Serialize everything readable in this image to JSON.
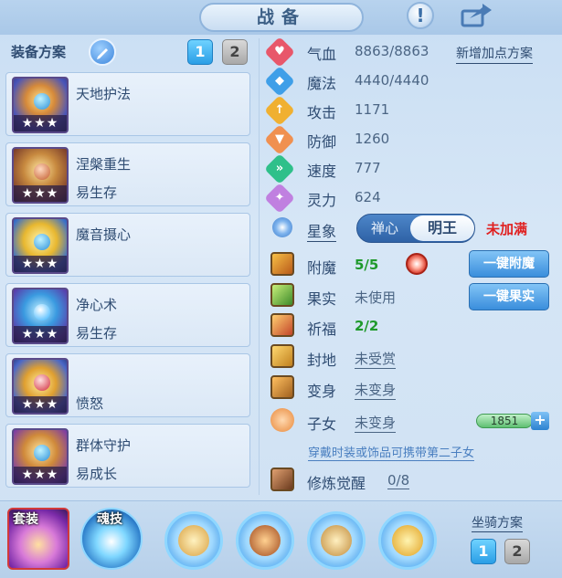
{
  "title": "战备",
  "left": {
    "plan_label": "装备方案",
    "plan_tabs": [
      "1",
      "2"
    ],
    "equipment": [
      {
        "name": "天地护法",
        "sub": "",
        "stars": "★★★"
      },
      {
        "name": "涅槃重生",
        "sub": "易生存",
        "stars": "★★★"
      },
      {
        "name": "魔音摄心",
        "sub": "",
        "stars": "★★★"
      },
      {
        "name": "净心术",
        "sub": "易生存",
        "stars": "★★★"
      },
      {
        "name": "",
        "sub": "愤怒",
        "stars": "★★★"
      },
      {
        "name": "群体守护",
        "sub": "易成长",
        "stars": "★★★"
      }
    ]
  },
  "stats": {
    "add_plan_link": "新增加点方案",
    "items": [
      {
        "label": "气血",
        "value": "8863/8863",
        "icon": "heart-icon",
        "color": "#e8576a"
      },
      {
        "label": "魔法",
        "value": "4440/4440",
        "icon": "mana-icon",
        "color": "#3f9fe8"
      },
      {
        "label": "攻击",
        "value": "1171",
        "icon": "attack-icon",
        "color": "#f0b030"
      },
      {
        "label": "防御",
        "value": "1260",
        "icon": "shield-icon",
        "color": "#f09050"
      },
      {
        "label": "速度",
        "value": "777",
        "icon": "speed-icon",
        "color": "#2fc08a"
      },
      {
        "label": "灵力",
        "value": "624",
        "icon": "spirit-icon",
        "color": "#c080e0"
      }
    ]
  },
  "xingxiang": {
    "label": "星象",
    "toggle_left": "禅心",
    "toggle_right": "明王",
    "status": "未加满"
  },
  "features": [
    {
      "label": "附魔",
      "value": "5/5",
      "icon": "enchant-icon"
    },
    {
      "label": "果实",
      "value": "未使用",
      "icon": "fruit-icon"
    },
    {
      "label": "祈福",
      "value": "2/2",
      "icon": "blessing-icon"
    },
    {
      "label": "封地",
      "value": "未受赏",
      "icon": "fief-icon"
    },
    {
      "label": "变身",
      "value": "未变身",
      "icon": "transform-icon"
    },
    {
      "label": "子女",
      "value": "未变身",
      "icon": "child-icon"
    },
    {
      "label": "修炼觉醒",
      "value": "0/8",
      "icon": "cultivate-icon"
    }
  ],
  "buttons": {
    "one_key_enchant": "一键附魔",
    "one_key_fruit": "一键果实"
  },
  "child": {
    "points": "1851",
    "hint": "穿戴时装或饰品可携带第二子女"
  },
  "bottom": {
    "suit_tag": "套装",
    "soul_tag": "魂技",
    "mount_label": "坐骑方案",
    "mount_tabs": [
      "1",
      "2"
    ]
  }
}
